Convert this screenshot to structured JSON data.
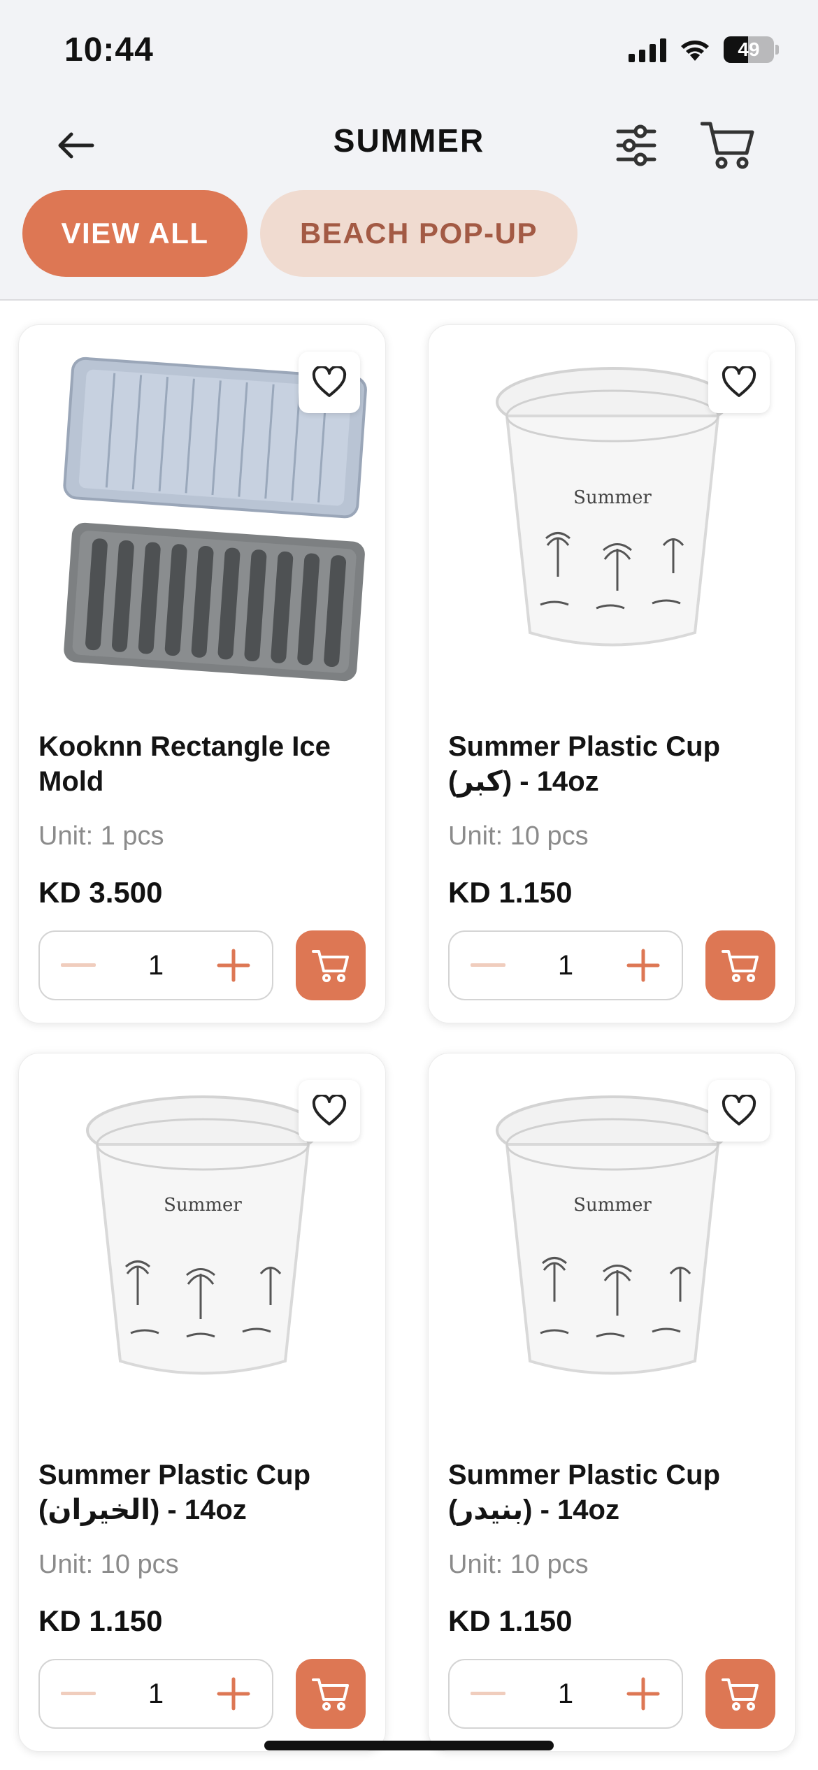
{
  "status_bar": {
    "time": "10:44",
    "battery": "49"
  },
  "header": {
    "title": "SUMMER"
  },
  "categories": [
    {
      "label": "VIEW ALL",
      "active": true
    },
    {
      "label": "BEACH POP-UP",
      "active": false
    }
  ],
  "colors": {
    "accent": "#dd7754",
    "accent_light": "#f0dbd0"
  },
  "products": [
    {
      "name": "Kooknn Rectangle Ice Mold",
      "unit": "Unit: 1 pcs",
      "price": "KD 3.500",
      "qty": "1",
      "image": "ice-mold-image"
    },
    {
      "name": "Summer Plastic Cup (كبر) - 14oz",
      "unit": "Unit: 10 pcs",
      "price": "KD 1.150",
      "qty": "1",
      "image": "plastic-cup-image"
    },
    {
      "name": "Summer Plastic Cup (الخيران) - 14oz",
      "unit": "Unit: 10 pcs",
      "price": "KD 1.150",
      "qty": "1",
      "image": "plastic-cup-image"
    },
    {
      "name": "Summer Plastic Cup (بنيدر) - 14oz",
      "unit": "Unit: 10 pcs",
      "price": "KD 1.150",
      "qty": "1",
      "image": "plastic-cup-image"
    }
  ]
}
